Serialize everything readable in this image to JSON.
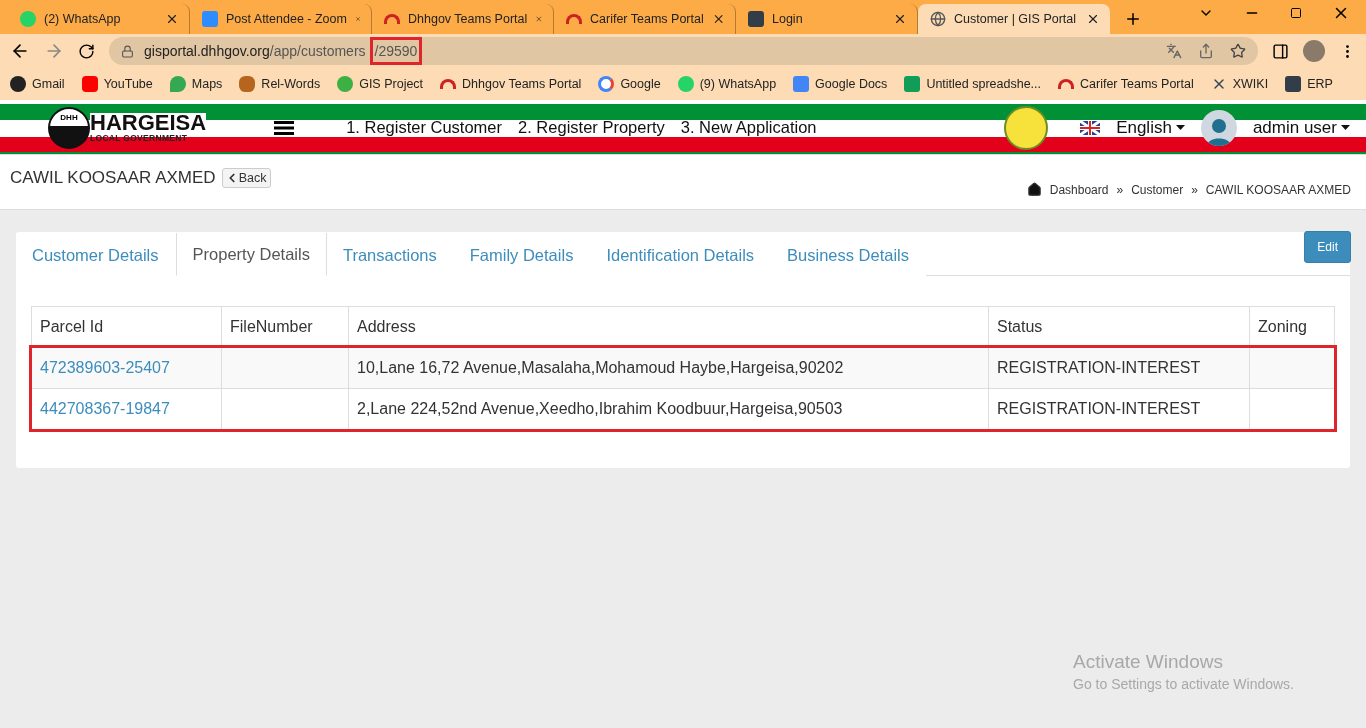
{
  "browser": {
    "tabs": [
      {
        "title": "(2) WhatsApp",
        "selected": false
      },
      {
        "title": "Post Attendee - Zoom",
        "selected": false
      },
      {
        "title": "Dhhgov Teams Portal",
        "selected": false
      },
      {
        "title": "Carifer Teams Portal",
        "selected": false
      },
      {
        "title": "Login",
        "selected": false
      },
      {
        "title": "Customer | GIS Portal",
        "selected": true
      }
    ],
    "url": {
      "host": "gisportal.dhhgov.org",
      "path": "/app/customers",
      "highlighted_part": "/29590"
    },
    "bookmarks": [
      "Gmail",
      "YouTube",
      "Maps",
      "Rel-Words",
      "GIS Project",
      "Dhhgov Teams Portal",
      "Google",
      "(9) WhatsApp",
      "Google Docs",
      "Untitled spreadshe...",
      "Carifer Teams Portal",
      "XWIKI",
      "ERP"
    ]
  },
  "header": {
    "logo_letters": "DHH",
    "logo_title": "HARGEISA",
    "logo_subtitle": "LOCAL GOVERNMENT",
    "nav": [
      "1. Register Customer",
      "2. Register Property",
      "3. New Application"
    ],
    "language": "English",
    "user": "admin user"
  },
  "page": {
    "title": "CAWIL KOOSAAR AXMED",
    "back": "Back",
    "breadcrumb": [
      "Dashboard",
      "Customer",
      "CAWIL KOOSAAR AXMED"
    ],
    "separator": "»"
  },
  "tabs": [
    {
      "label": "Customer Details",
      "selected": false
    },
    {
      "label": "Property Details",
      "selected": true
    },
    {
      "label": "Transactions",
      "selected": false
    },
    {
      "label": "Family Details",
      "selected": false
    },
    {
      "label": "Identification Details",
      "selected": false
    },
    {
      "label": "Business Details",
      "selected": false
    }
  ],
  "edit_button": "Edit",
  "table": {
    "columns": [
      "Parcel Id",
      "FileNumber",
      "Address",
      "Status",
      "Zoning"
    ],
    "rows_highlighted": true,
    "rows": [
      {
        "parcel_id": "472389603-25407",
        "address": "10,Lane 16,72 Avenue,Masalaha,Mohamoud Haybe,Hargeisa,90202",
        "status": "REGISTRATION-INTEREST"
      },
      {
        "parcel_id": "442708367-19847",
        "address": "2,Lane 224,52nd Avenue,Xeedho,Ibrahim Koodbuur,Hargeisa,90503",
        "status": "REGISTRATION-INTEREST"
      }
    ]
  },
  "os_notice": {
    "title": "Activate Windows",
    "text": "Go to Settings to activate Windows."
  }
}
